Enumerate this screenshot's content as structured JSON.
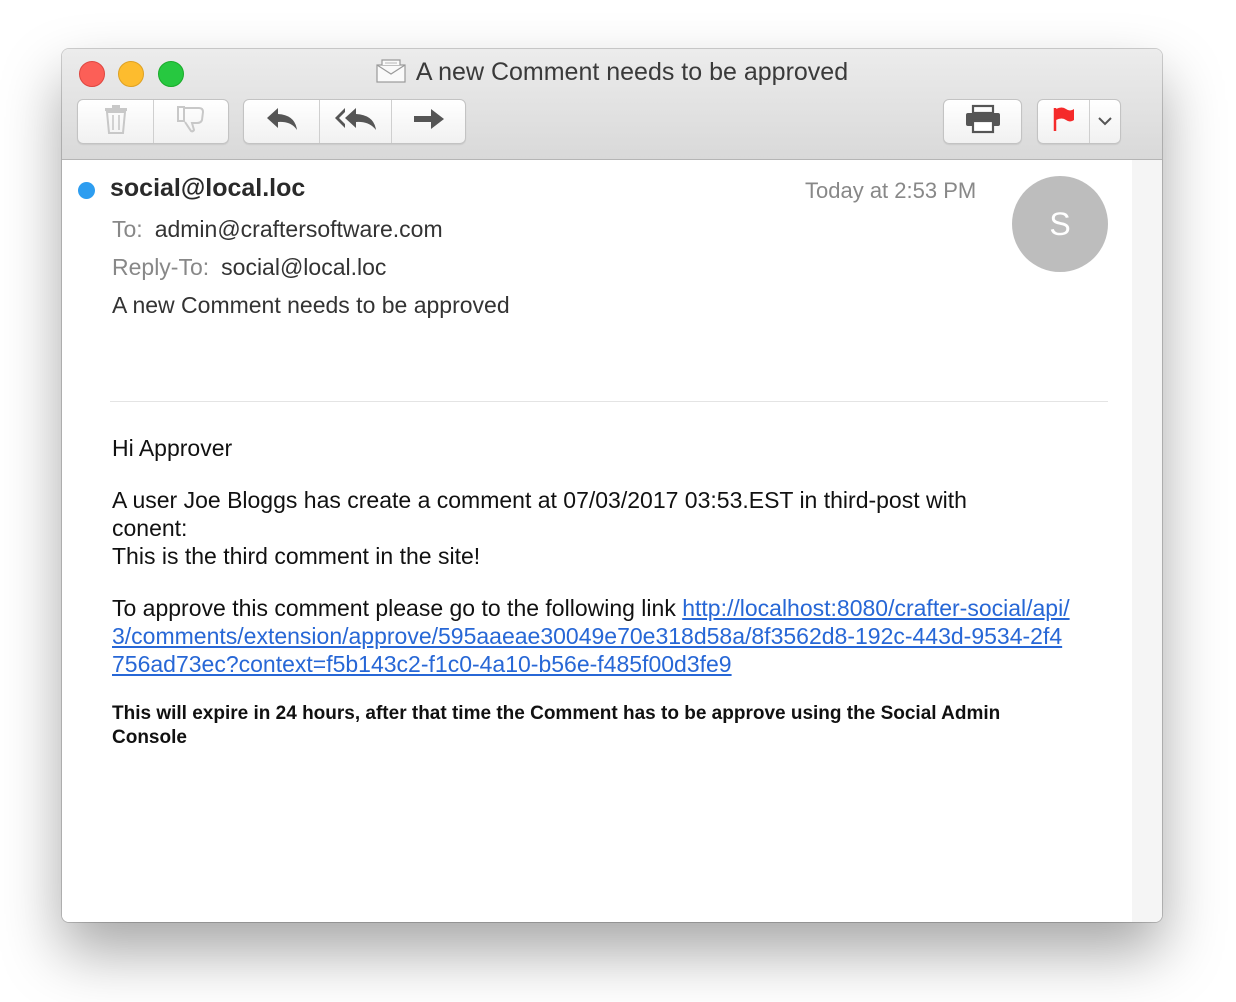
{
  "window": {
    "title": "A new Comment needs to be approved"
  },
  "toolbar": {
    "delete_icon": "trash-icon",
    "junk_icon": "thumbs-down-icon",
    "reply_icon": "reply-icon",
    "reply_all_icon": "reply-all-icon",
    "forward_icon": "forward-icon",
    "print_icon": "printer-icon",
    "flag_icon": "flag-icon",
    "flag_color": "#f52a2a"
  },
  "message": {
    "from": "social@local.loc",
    "date": "Today at 2:53 PM",
    "avatar_initial": "S",
    "to_label": "To:",
    "to": "admin@craftersoftware.com",
    "reply_to_label": "Reply-To:",
    "reply_to": "social@local.loc",
    "subject": "A new Comment needs to be approved",
    "unread_color": "#2d9df0"
  },
  "body": {
    "greeting": "Hi Approver",
    "paragraph1_line1": "A user Joe Bloggs has create a comment at 07/03/2017 03:53.EST in third-post with conent:",
    "paragraph1_line2": "This is the third comment in the site!",
    "paragraph2_text": "To approve this comment please go to the following link ",
    "link_url": "http://localhost:8080/crafter-social/api/3/comments/extension/approve/595aaeae30049e70e318d58a/8f3562d8-192c-443d-9534-2f4756ad73ec?context=f5b143c2-f1c0-4a10-b56e-f485f00d3fe9",
    "expire_note": "This will expire in 24 hours, after that time the Comment has to be approve using the Social Admin Console"
  }
}
